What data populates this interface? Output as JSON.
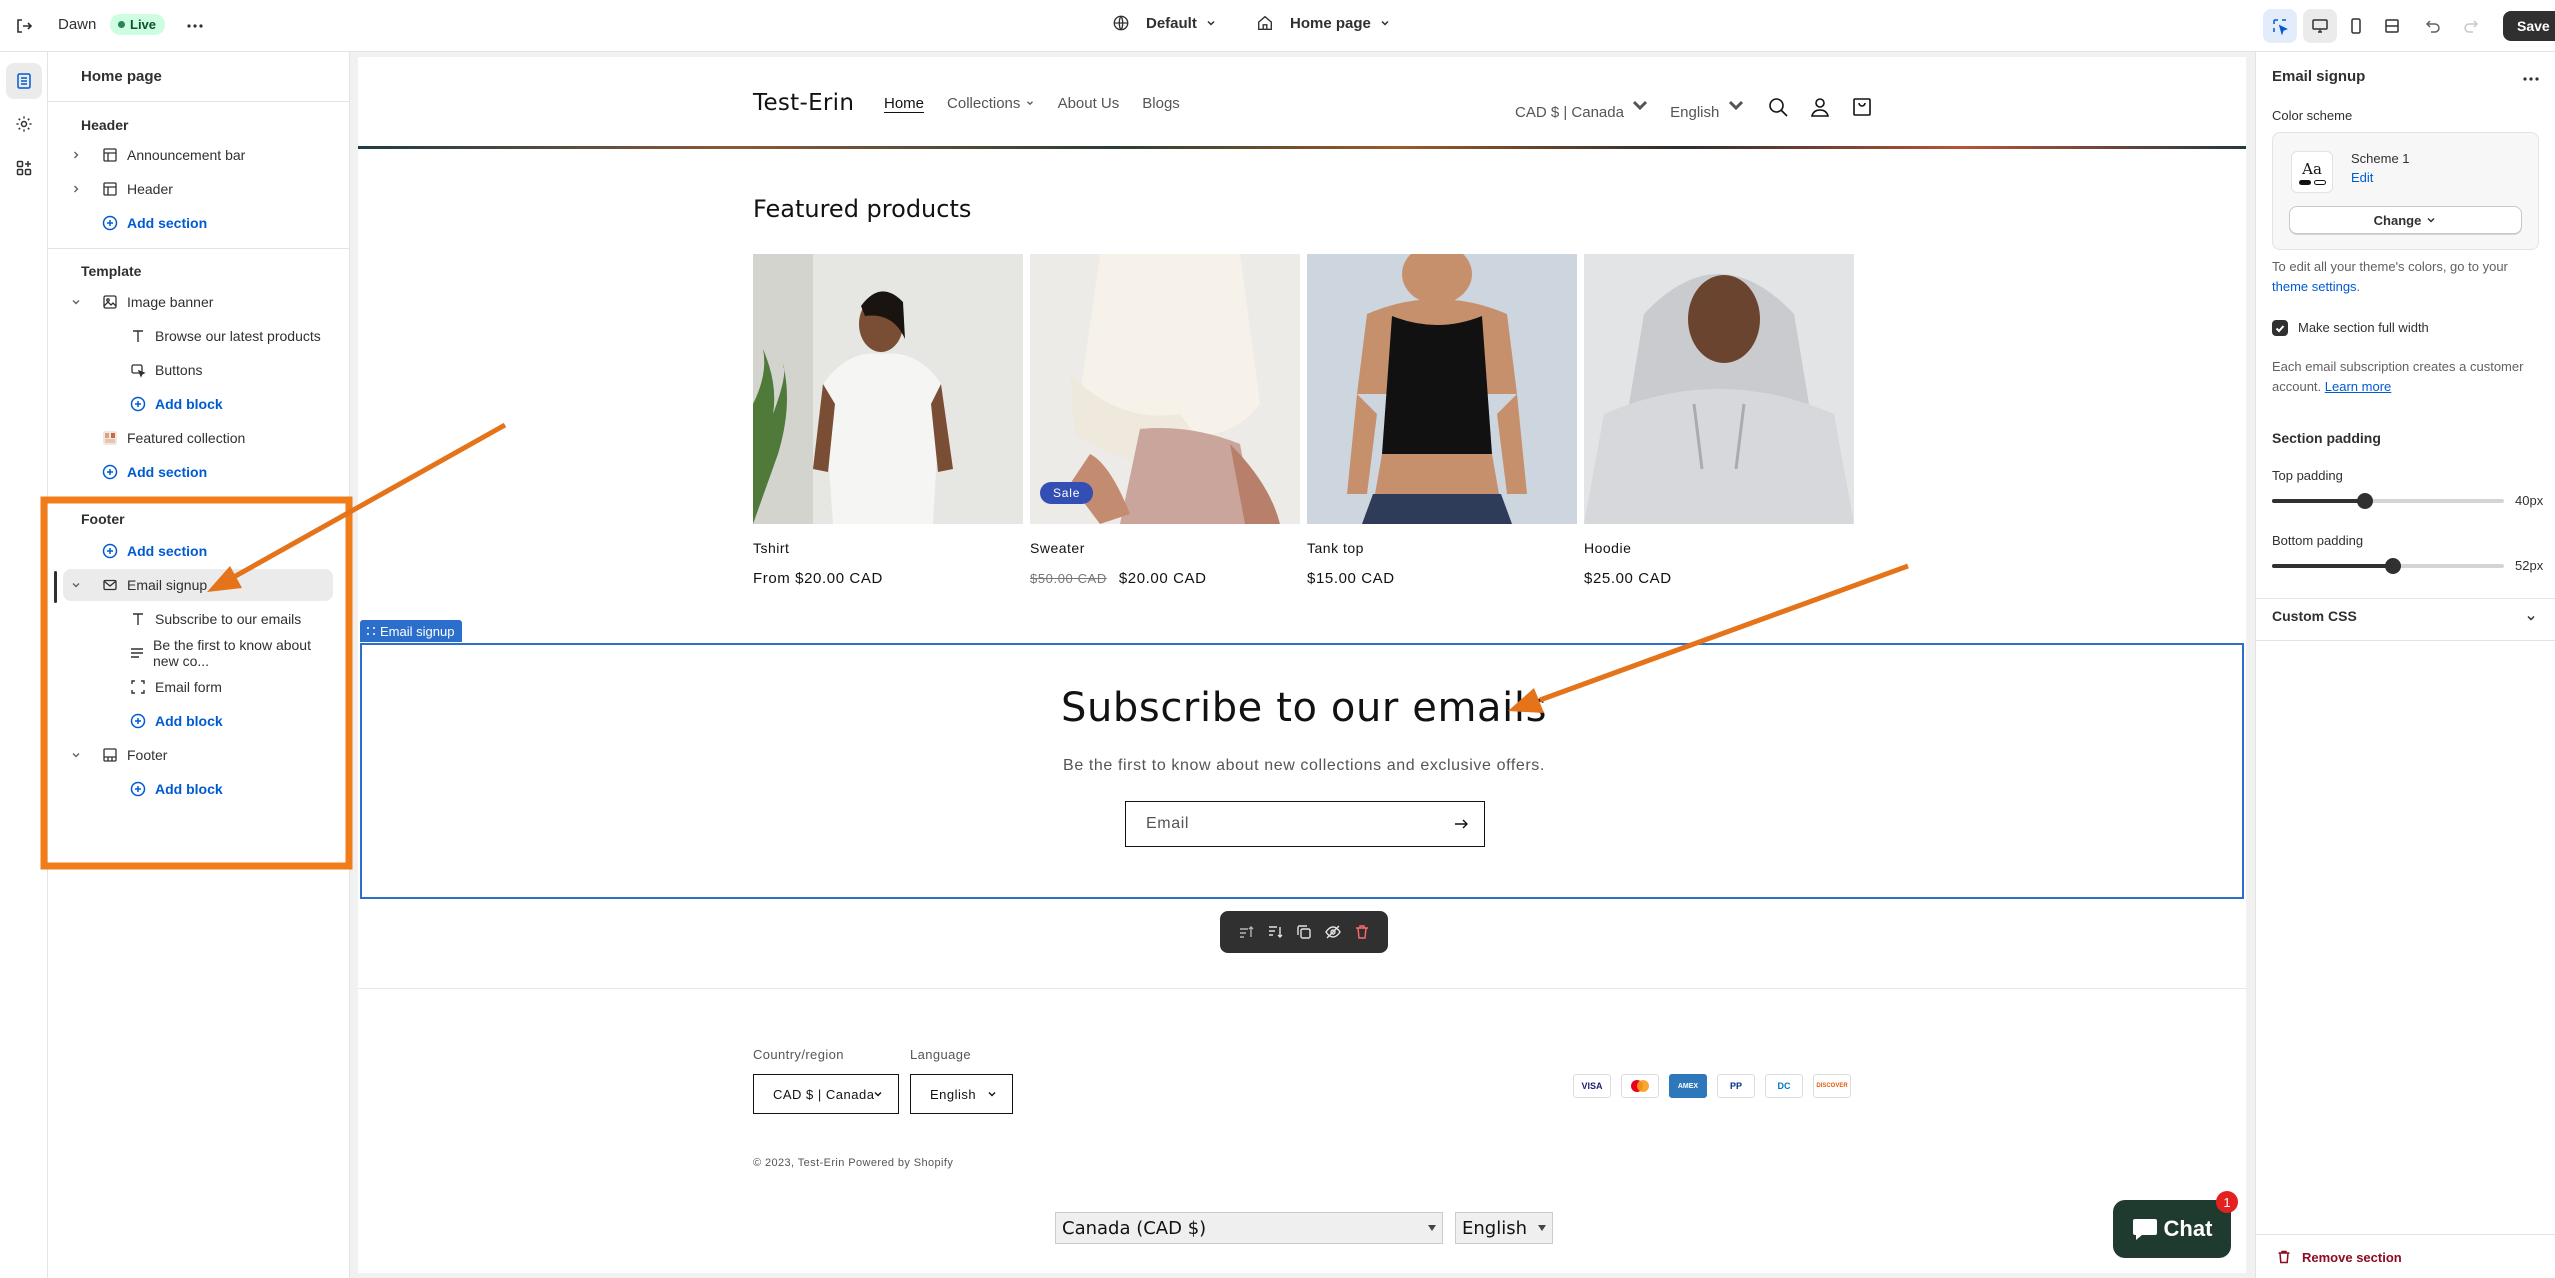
{
  "topbar": {
    "theme_name": "Dawn",
    "live_label": "Live",
    "theme_preset": "Default",
    "page_selector": "Home page",
    "save_label": "Save"
  },
  "left_panel": {
    "title": "Home page",
    "header_group": "Header",
    "header_items": [
      {
        "label": "Announcement bar"
      },
      {
        "label": "Header"
      }
    ],
    "add_section": "Add section",
    "template_group": "Template",
    "image_banner": "Image banner",
    "image_banner_blocks": [
      {
        "label": "Browse our latest products"
      },
      {
        "label": "Buttons"
      }
    ],
    "add_block": "Add block",
    "featured_collection": "Featured collection",
    "footer_group": "Footer",
    "email_signup": "Email signup",
    "email_signup_blocks": [
      {
        "label": "Subscribe to our emails"
      },
      {
        "label": "Be the first to know about new co..."
      },
      {
        "label": "Email form"
      }
    ],
    "footer_section": "Footer"
  },
  "store": {
    "logo": "Test-Erin",
    "nav": [
      "Home",
      "Collections",
      "About Us",
      "Blogs"
    ],
    "currency": "CAD $ | Canada",
    "language": "English",
    "featured_title": "Featured products",
    "products": [
      {
        "name": "Tshirt",
        "price": "From $20.00 CAD"
      },
      {
        "name": "Sweater",
        "old_price": "$50.00 CAD",
        "price": "$20.00 CAD",
        "badge": "Sale"
      },
      {
        "name": "Tank top",
        "price": "$15.00 CAD"
      },
      {
        "name": "Hoodie",
        "price": "$25.00 CAD"
      }
    ],
    "email_tag": "Email signup",
    "email_title": "Subscribe to our emails",
    "email_sub": "Be the first to know about new collections and exclusive offers.",
    "email_placeholder": "Email",
    "footer": {
      "country_label": "Country/region",
      "country_value": "CAD $ | Canada",
      "language_label": "Language",
      "language_value": "English",
      "payments": [
        "VISA",
        "MC",
        "AMEX",
        "PP",
        "DC",
        "DISCOVER"
      ],
      "copyright_prefix": "© 2023, ",
      "copyright_store": "Test-Erin",
      "copyright_powered": "Powered by Shopify",
      "native_country": "Canada (CAD $)",
      "native_language": "English"
    },
    "chat_label": "Chat",
    "chat_badge": "1"
  },
  "right_panel": {
    "title": "Email signup",
    "color_scheme_label": "Color scheme",
    "scheme_glyph": "Aa",
    "scheme_name": "Scheme 1",
    "scheme_edit": "Edit",
    "change_label": "Change",
    "help_prefix": "To edit all your theme's colors, go to your",
    "help_link": "theme settings",
    "help_suffix": ".",
    "full_width_label": "Make section full width",
    "full_width_checked": true,
    "subscription_note": "Each email subscription creates a customer account.",
    "learn_more": "Learn more",
    "section_padding": "Section padding",
    "top_padding_label": "Top padding",
    "top_padding_value": "40px",
    "top_padding_fraction": 0.4,
    "bottom_padding_label": "Bottom padding",
    "bottom_padding_value": "52px",
    "bottom_padding_fraction": 0.52,
    "custom_css": "Custom CSS",
    "remove_section": "Remove section"
  },
  "colors": {
    "accent_blue": "#005bd3",
    "selection_blue": "#2c6ecb",
    "annotation_orange": "#f07c1a",
    "live_green": "#29845a",
    "danger": "#8e0b21"
  }
}
